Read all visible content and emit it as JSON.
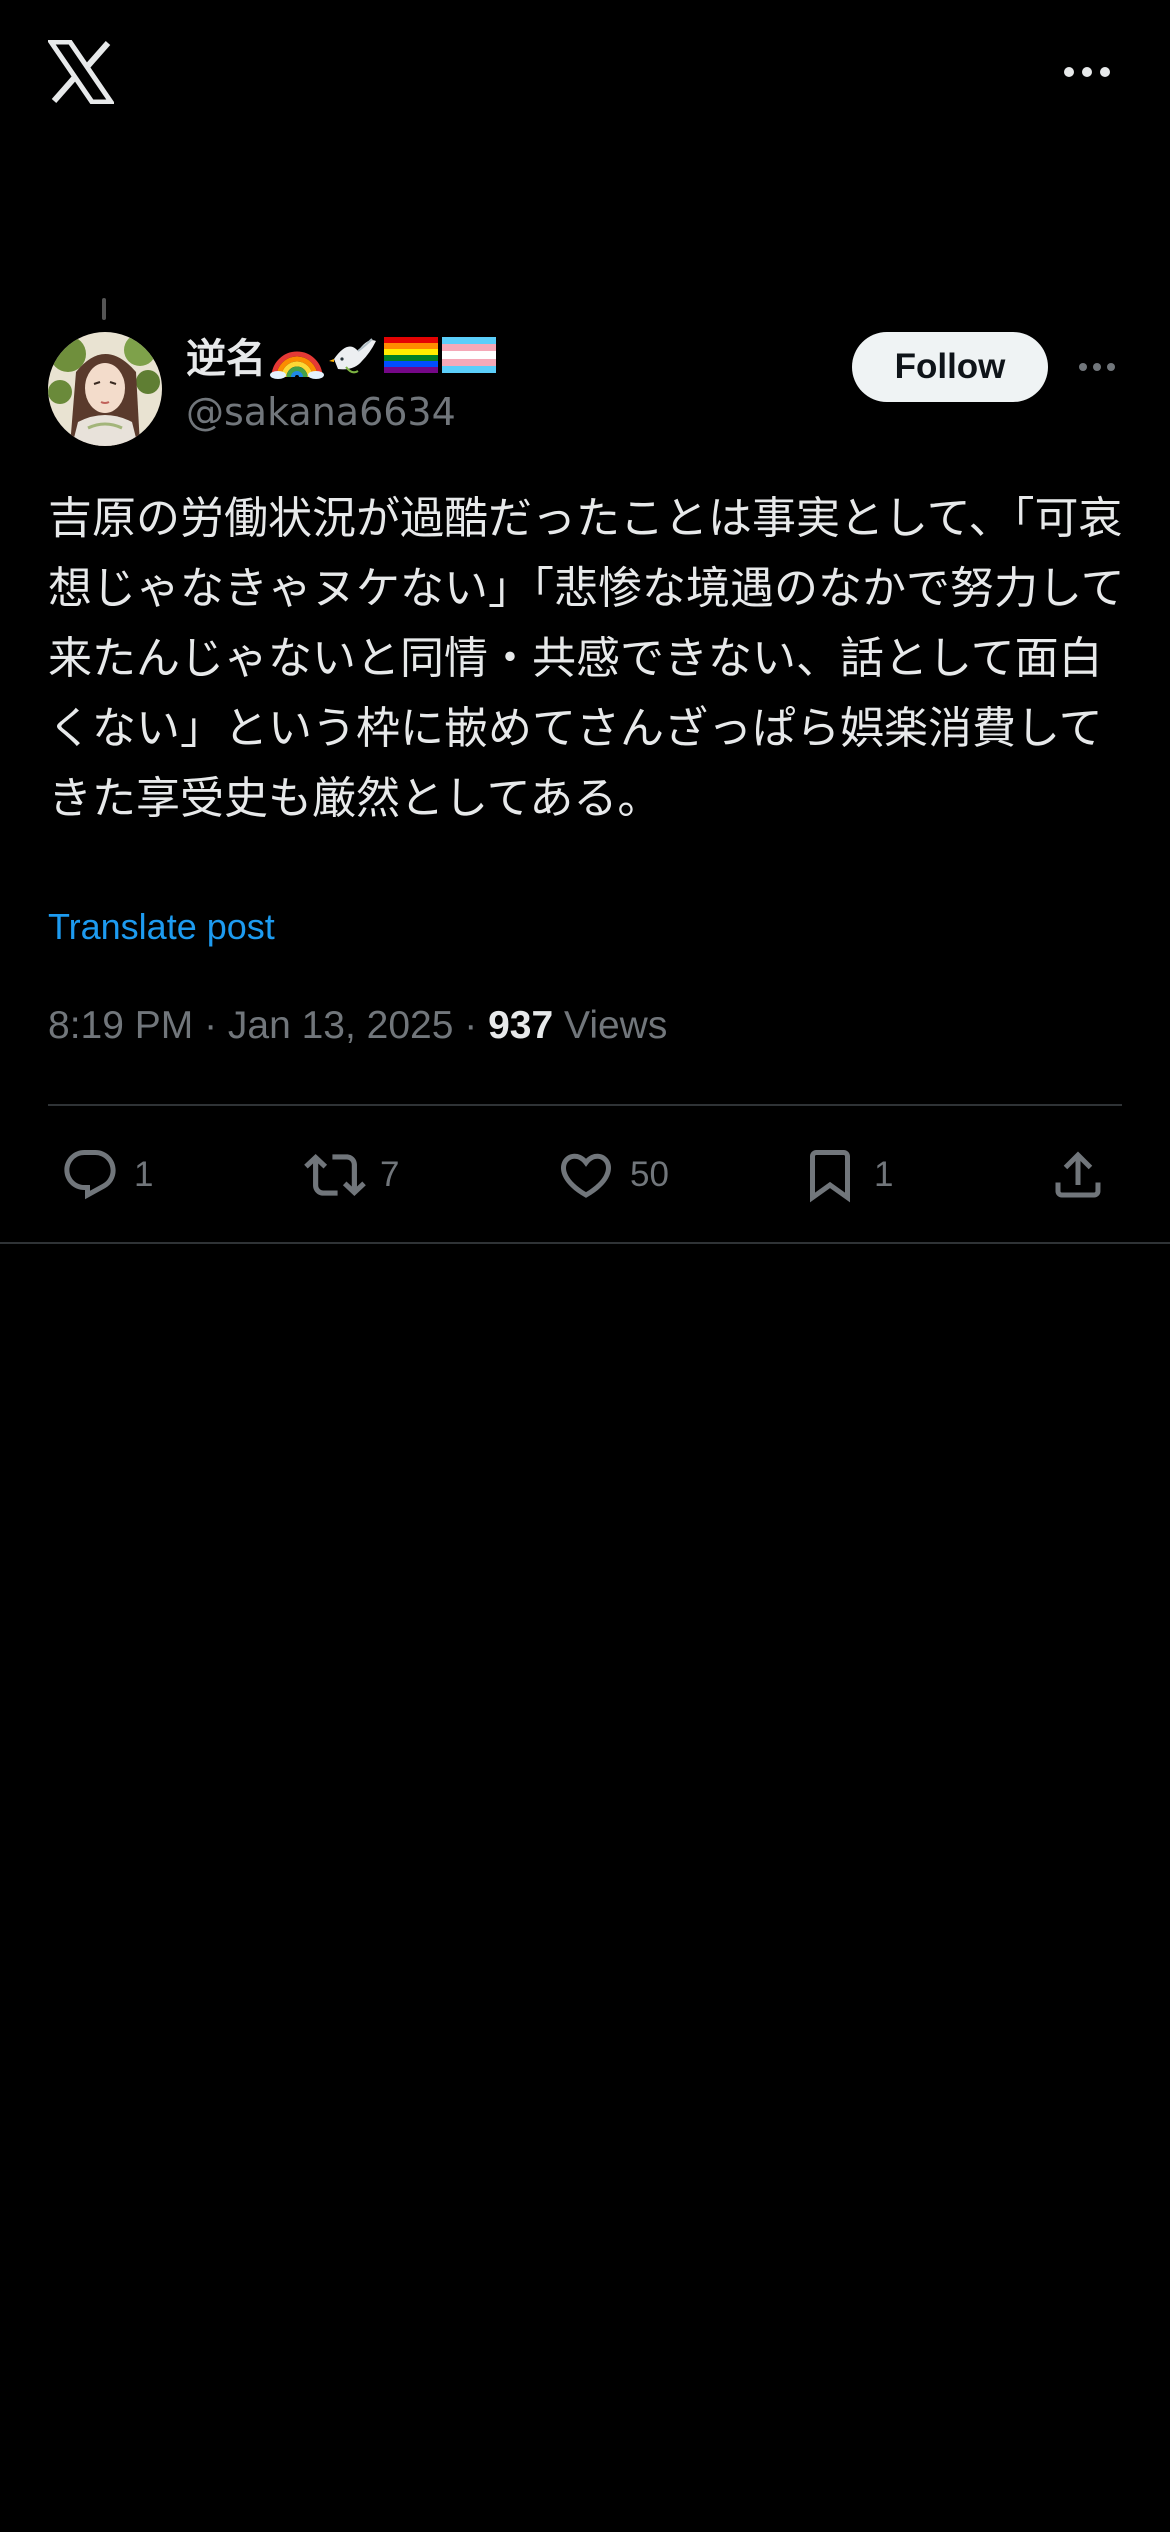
{
  "header": {
    "logo_icon": "x-logo-icon",
    "more_icon": "more-horizontal-icon"
  },
  "post": {
    "author": {
      "display_name": "逆名",
      "name_emojis": [
        "rainbow-emoji",
        "dove-emoji",
        "rainbow-flag-emoji",
        "transgender-flag-emoji"
      ],
      "handle": "@sakana6634"
    },
    "follow_label": "Follow",
    "text": "吉原の労働状況が過酷だったことは事実として、「可哀想じゃなきゃヌケない」「悲惨な境遇のなかで努力して来たんじゃないと同情・共感できない、話として面白くない」という枠に嵌めてさんざっぱら娯楽消費してきた享受史も厳然としてある。",
    "translate_label": "Translate post",
    "time": "8:19 PM · Jan 13, 2025 · ",
    "views_count": "937",
    "views_label": " Views"
  },
  "actions": {
    "reply": {
      "icon": "reply-icon",
      "count": "1"
    },
    "repost": {
      "icon": "repost-icon",
      "count": "7"
    },
    "like": {
      "icon": "heart-icon",
      "count": "50"
    },
    "bookmark": {
      "icon": "bookmark-icon",
      "count": "1"
    },
    "share": {
      "icon": "share-icon"
    }
  },
  "colors": {
    "background": "#000000",
    "text": "#e7e9ea",
    "secondary": "#71767b",
    "link": "#1d9bf0",
    "divider": "#2f3336",
    "follow_bg": "#eff3f4"
  }
}
